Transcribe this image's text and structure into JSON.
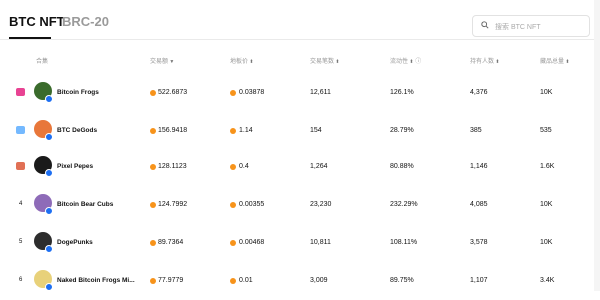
{
  "tabs": [
    {
      "label": "BTC NFT",
      "active": true
    },
    {
      "label": "BRC-20",
      "active": false
    }
  ],
  "search": {
    "placeholder": "搜索 BTC NFT"
  },
  "columns": {
    "collection": "合集",
    "volume": "交易额",
    "floor": "地板价",
    "transactions": "交易笔数",
    "liquidity": "流动性",
    "holders": "持有人数",
    "supply": "藏品总量"
  },
  "rows": [
    {
      "rank": "",
      "rank_icon": "trophy-icon",
      "name": "Bitcoin Frogs",
      "volume": "522.6873",
      "floor": "0.03878",
      "transactions": "12,611",
      "liquidity": "126.1%",
      "holders": "4,376",
      "supply": "10K"
    },
    {
      "rank": "",
      "rank_icon": "trophy-icon",
      "name": "BTC DeGods",
      "volume": "156.9418",
      "floor": "1.14",
      "transactions": "154",
      "liquidity": "28.79%",
      "holders": "385",
      "supply": "535"
    },
    {
      "rank": "",
      "rank_icon": "trophy-icon",
      "name": "Pixel Pepes",
      "volume": "128.1123",
      "floor": "0.4",
      "transactions": "1,264",
      "liquidity": "80.88%",
      "holders": "1,146",
      "supply": "1.6K"
    },
    {
      "rank": "4",
      "name": "Bitcoin Bear Cubs",
      "volume": "124.7992",
      "floor": "0.00355",
      "transactions": "23,230",
      "liquidity": "232.29%",
      "holders": "4,085",
      "supply": "10K"
    },
    {
      "rank": "5",
      "name": "DogePunks",
      "volume": "89.7364",
      "floor": "0.00468",
      "transactions": "10,811",
      "liquidity": "108.11%",
      "holders": "3,578",
      "supply": "10K"
    },
    {
      "rank": "6",
      "name": "Naked Bitcoin Frogs Mi...",
      "volume": "77.9779",
      "floor": "0.01",
      "transactions": "3,009",
      "liquidity": "89.75%",
      "holders": "1,107",
      "supply": "3.4K"
    }
  ],
  "colors": {
    "coin": "#f7931a",
    "verify": "#1d6ff2",
    "rank1": "#e84393",
    "rank2": "#74b9ff",
    "rank3": "#e17055"
  }
}
